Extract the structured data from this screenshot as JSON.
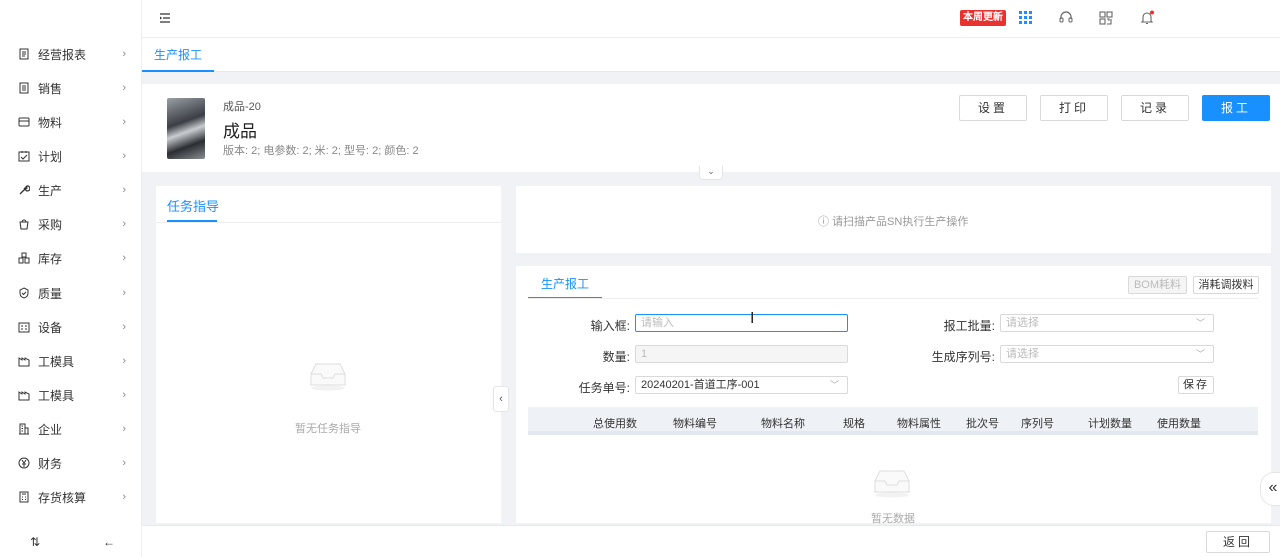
{
  "sidebar": {
    "items": [
      {
        "label": "经营报表",
        "icon": "report-icon"
      },
      {
        "label": "销售",
        "icon": "sales-icon"
      },
      {
        "label": "物料",
        "icon": "material-icon"
      },
      {
        "label": "计划",
        "icon": "plan-icon"
      },
      {
        "label": "生产",
        "icon": "wrench-icon"
      },
      {
        "label": "采购",
        "icon": "purchase-icon"
      },
      {
        "label": "库存",
        "icon": "inventory-icon"
      },
      {
        "label": "质量",
        "icon": "shield-icon"
      },
      {
        "label": "设备",
        "icon": "equipment-icon"
      },
      {
        "label": "工模具",
        "icon": "mold-icon"
      },
      {
        "label": "工模具",
        "icon": "mold-icon"
      },
      {
        "label": "企业",
        "icon": "building-icon"
      },
      {
        "label": "财务",
        "icon": "yen-icon"
      },
      {
        "label": "存货核算",
        "icon": "calculator-icon"
      }
    ],
    "bottom_left": "⇅",
    "bottom_right": "←"
  },
  "topbar": {
    "update_badge": "本周更新"
  },
  "tabs": {
    "active": "生产报工"
  },
  "product": {
    "code": "成品-20",
    "name": "成品",
    "attrs": "版本: 2; 电参数: 2; 米: 2; 型号: 2; 颜色: 2",
    "buttons": {
      "settings": "设置",
      "print": "打印",
      "records": "记录",
      "report": "报工"
    }
  },
  "task_guide": {
    "title": "任务指导",
    "empty": "暂无任务指导"
  },
  "scan": {
    "hint": "请扫描产品SN执行生产操作"
  },
  "report": {
    "tab": "生产报工",
    "bom_btn": "BOM耗料",
    "consume_btn": "消耗调拨料",
    "fields": {
      "input_label": "输入框:",
      "input_placeholder": "请输入",
      "batch_label": "报工批量:",
      "batch_placeholder": "请选择",
      "qty_label": "数量:",
      "qty_value": "1",
      "serial_label": "生成序列号:",
      "serial_placeholder": "请选择",
      "task_label": "任务单号:",
      "task_value": "20240201-首道工序-001"
    },
    "save": "保存",
    "columns": [
      "总使用数",
      "物料编号",
      "物料名称",
      "规格",
      "物料属性",
      "批次号",
      "序列号",
      "计划数量",
      "使用数量"
    ],
    "empty": "暂无数据"
  },
  "footer": {
    "back": "返回"
  },
  "colors": {
    "primary": "#1890ff",
    "badge": "#e8322f"
  }
}
